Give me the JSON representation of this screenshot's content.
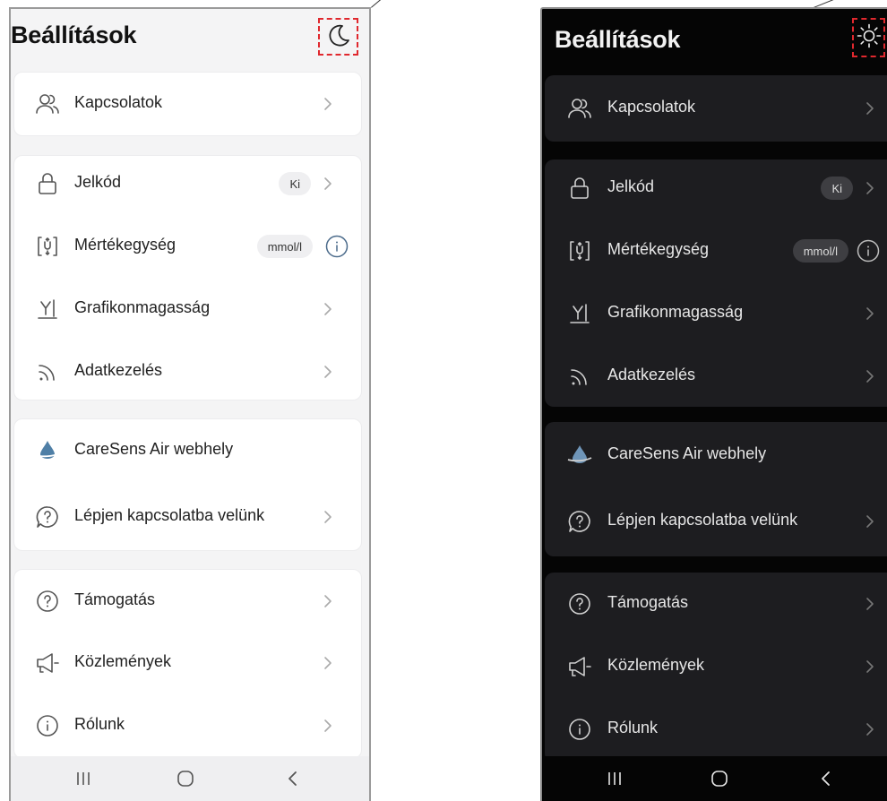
{
  "screens": [
    {
      "mode": "light",
      "header": {
        "title": "Beállítások",
        "theme_toggle_icon": "moon-icon"
      },
      "groups": [
        {
          "items": [
            {
              "label": "Kapcsolatok",
              "icon": "contacts-icon",
              "chevron": true
            }
          ]
        },
        {
          "items": [
            {
              "label": "Jelkód",
              "icon": "lock-icon",
              "badge": "Ki",
              "chevron": true
            },
            {
              "label": "Mértékegység",
              "icon": "unit-swap-icon",
              "badge": "mmol/l",
              "info": true
            },
            {
              "label": "Grafikonmagasság",
              "icon": "graph-height-icon",
              "chevron": true
            },
            {
              "label": "Adatkezelés",
              "icon": "data-feed-icon",
              "chevron": true
            }
          ]
        },
        {
          "items": [
            {
              "label": "CareSens Air webhely",
              "icon": "caresens-drop-icon"
            },
            {
              "label": "Lépjen kapcsolatba velünk",
              "icon": "chat-question-icon",
              "chevron": true
            }
          ]
        },
        {
          "items": [
            {
              "label": "Támogatás",
              "icon": "help-circle-icon",
              "chevron": true
            },
            {
              "label": "Közlemények",
              "icon": "megaphone-icon",
              "chevron": true
            },
            {
              "label": "Rólunk",
              "icon": "info-circle-icon",
              "chevron": true
            }
          ]
        }
      ],
      "nav_buttons": [
        "recent-apps-icon",
        "home-icon",
        "back-icon"
      ]
    },
    {
      "mode": "dark",
      "header": {
        "title": "Beállítások",
        "theme_toggle_icon": "sun-icon"
      },
      "groups": [
        {
          "items": [
            {
              "label": "Kapcsolatok",
              "icon": "contacts-icon",
              "chevron": true
            }
          ]
        },
        {
          "items": [
            {
              "label": "Jelkód",
              "icon": "lock-icon",
              "badge": "Ki",
              "chevron": true
            },
            {
              "label": "Mértékegység",
              "icon": "unit-swap-icon",
              "badge": "mmol/l",
              "info": true
            },
            {
              "label": "Grafikonmagasság",
              "icon": "graph-height-icon",
              "chevron": true
            },
            {
              "label": "Adatkezelés",
              "icon": "data-feed-icon",
              "chevron": true
            }
          ]
        },
        {
          "items": [
            {
              "label": "CareSens Air webhely",
              "icon": "caresens-drop-icon"
            },
            {
              "label": "Lépjen kapcsolatba velünk",
              "icon": "chat-question-icon",
              "chevron": true
            }
          ]
        },
        {
          "items": [
            {
              "label": "Támogatás",
              "icon": "help-circle-icon",
              "chevron": true
            },
            {
              "label": "Közlemények",
              "icon": "megaphone-icon",
              "chevron": true
            },
            {
              "label": "Rólunk",
              "icon": "info-circle-icon",
              "chevron": true
            }
          ]
        }
      ],
      "nav_buttons": [
        "recent-apps-icon",
        "home-icon",
        "back-icon"
      ]
    }
  ],
  "colors": {
    "light_background": "#f4f4f5",
    "light_card": "#ffffff",
    "dark_background": "#050505",
    "dark_card": "#1d1d20",
    "highlight_dash": "#e0282e"
  }
}
